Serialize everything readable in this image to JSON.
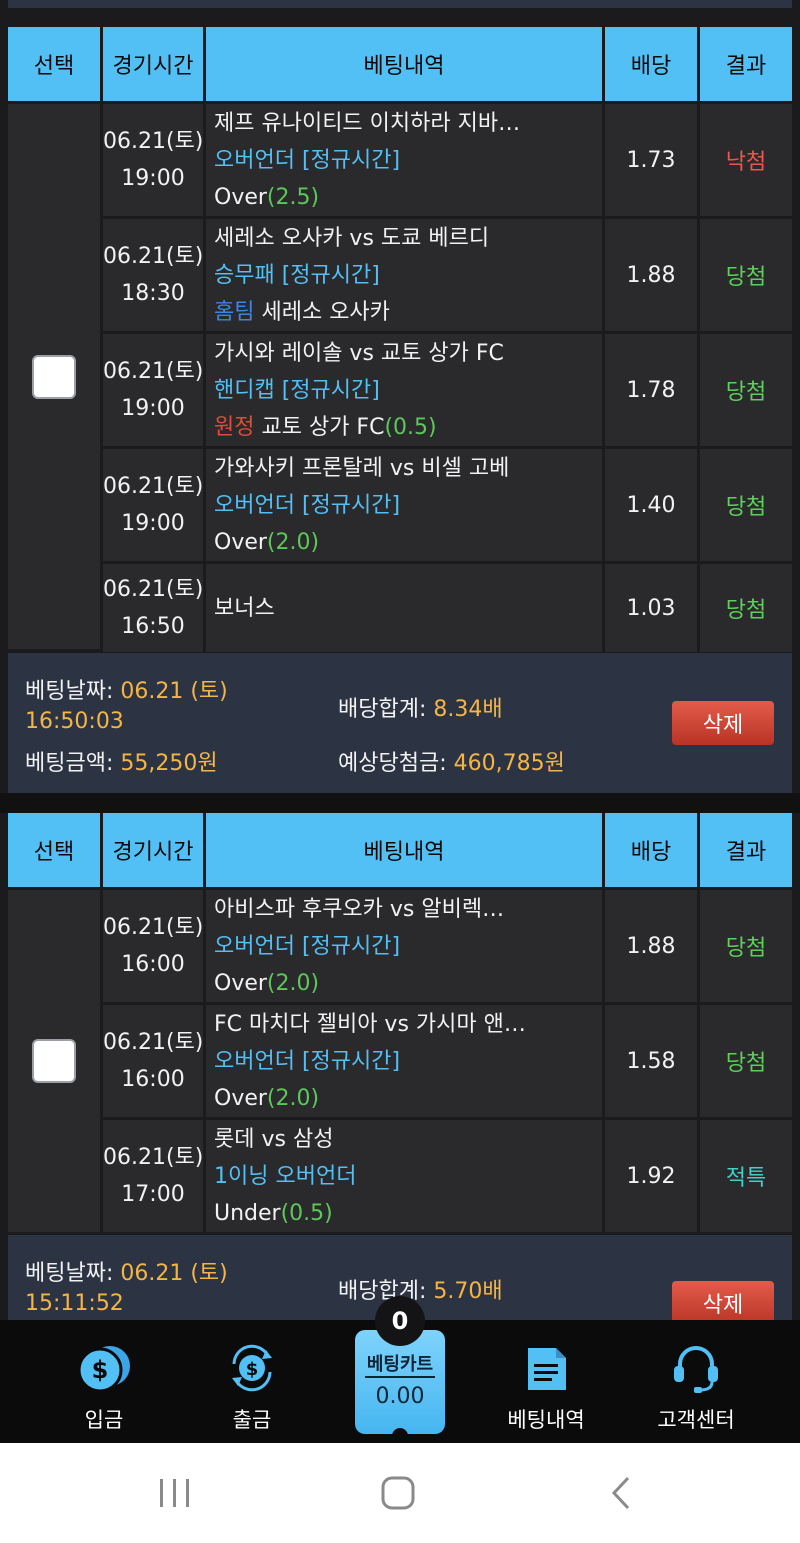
{
  "headers": {
    "select": "선택",
    "time": "경기시간",
    "details": "베팅내역",
    "odds": "배당",
    "result": "결과"
  },
  "bets": [
    {
      "rows": [
        {
          "date": "06.21(토)",
          "time": "19:00",
          "match": "제프 유나이티드 이치하라 지바…",
          "market": "오버언더 [정규시간]",
          "pick_prefix": "",
          "pick": "Over",
          "line": "(2.5)",
          "odds": "1.73",
          "result": "낙첨"
        },
        {
          "date": "06.21(토)",
          "time": "18:30",
          "match": "세레소 오사카 vs 도쿄 베르디",
          "market": "승무패 [정규시간]",
          "pick_prefix": "홈팀",
          "pick": " 세레소 오사카",
          "line": "",
          "odds": "1.88",
          "result": "당첨"
        },
        {
          "date": "06.21(토)",
          "time": "19:00",
          "match": "가시와 레이솔 vs 교토 상가 FC",
          "market": "핸디캡 [정규시간]",
          "pick_prefix": "원정",
          "pick": " 교토 상가 FC",
          "line": "(0.5)",
          "odds": "1.78",
          "result": "당첨"
        },
        {
          "date": "06.21(토)",
          "time": "19:00",
          "match": "가와사키 프론탈레 vs 비셀 고베",
          "market": "오버언더 [정규시간]",
          "pick_prefix": "",
          "pick": "Over",
          "line": "(2.0)",
          "odds": "1.40",
          "result": "당첨"
        },
        {
          "date": "06.21(토)",
          "time": "16:50",
          "match": "보너스",
          "market": "",
          "pick_prefix": "",
          "pick": "",
          "line": "",
          "odds": "1.03",
          "result": "당첨"
        }
      ],
      "summary": {
        "date_label": "베팅날짜:",
        "date_value": "06.21 (토)",
        "time_value": "16:50:03",
        "amount_label": "베팅금액:",
        "amount_value": "55,250원",
        "total_odds_label": "배당합계:",
        "total_odds_value": "8.34배",
        "expected_label": "예상당첨금:",
        "expected_value": "460,785원",
        "delete_label": "삭제"
      }
    },
    {
      "rows": [
        {
          "date": "06.21(토)",
          "time": "16:00",
          "match": "아비스파 후쿠오카 vs 알비렉…",
          "market": "오버언더 [정규시간]",
          "pick_prefix": "",
          "pick": "Over",
          "line": "(2.0)",
          "odds": "1.88",
          "result": "당첨"
        },
        {
          "date": "06.21(토)",
          "time": "16:00",
          "match": "FC 마치다 젤비아 vs 가시마 앤…",
          "market": "오버언더 [정규시간]",
          "pick_prefix": "",
          "pick": "Over",
          "line": "(2.0)",
          "odds": "1.58",
          "result": "당첨"
        },
        {
          "date": "06.21(토)",
          "time": "17:00",
          "match": "롯데 vs 삼성",
          "market": "1이닝 오버언더",
          "pick_prefix": "",
          "pick": "Under",
          "line": "(0.5)",
          "odds": "1.92",
          "result": "적특"
        }
      ],
      "summary": {
        "date_label": "베팅날짜:",
        "date_value": "06.21 (토)",
        "time_value": "15:11:52",
        "total_odds_label": "배당합계:",
        "total_odds_value": "5.70배",
        "delete_label": "삭제"
      }
    }
  ],
  "bottom_nav": {
    "deposit": "입금",
    "withdraw": "출금",
    "history": "베팅내역",
    "support": "고객센터"
  },
  "cart": {
    "count": "0",
    "title": "베팅카트",
    "amount": "0.00"
  },
  "colors": {
    "header_bg": "#52bff5",
    "win": "#5dd05a",
    "lose": "#e9584a",
    "accent_orange": "#f5b545",
    "delete_red": "#c9402f"
  }
}
